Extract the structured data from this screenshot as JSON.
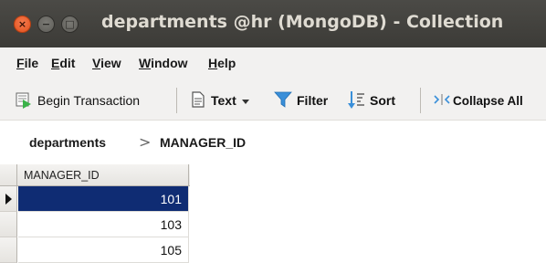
{
  "window": {
    "title": "departments @hr (MongoDB) - Collection",
    "close_glyph": "×",
    "minimize_glyph": "−",
    "maximize_glyph": "□"
  },
  "menu": {
    "items": [
      {
        "accel": "F",
        "rest": "ile"
      },
      {
        "accel": "E",
        "rest": "dit"
      },
      {
        "accel": "V",
        "rest": "iew"
      },
      {
        "accel": "W",
        "rest": "indow"
      },
      {
        "accel": "H",
        "rest": "elp"
      }
    ]
  },
  "toolbar": {
    "begin_transaction": "Begin Transaction",
    "text": "Text",
    "filter": "Filter",
    "sort": "Sort",
    "collapse_all": "Collapse All",
    "colors": {
      "filter_icon": "#3a8fd9",
      "sort_icon": "#3a8fd9",
      "transaction_icon": "#3bb24a"
    }
  },
  "breadcrumb": {
    "collection": "departments",
    "separator": ">",
    "field": "MANAGER_ID"
  },
  "grid": {
    "column_header": "MANAGER_ID",
    "rows": [
      "101",
      "103",
      "105"
    ],
    "selected_color": "#0f2c73"
  }
}
